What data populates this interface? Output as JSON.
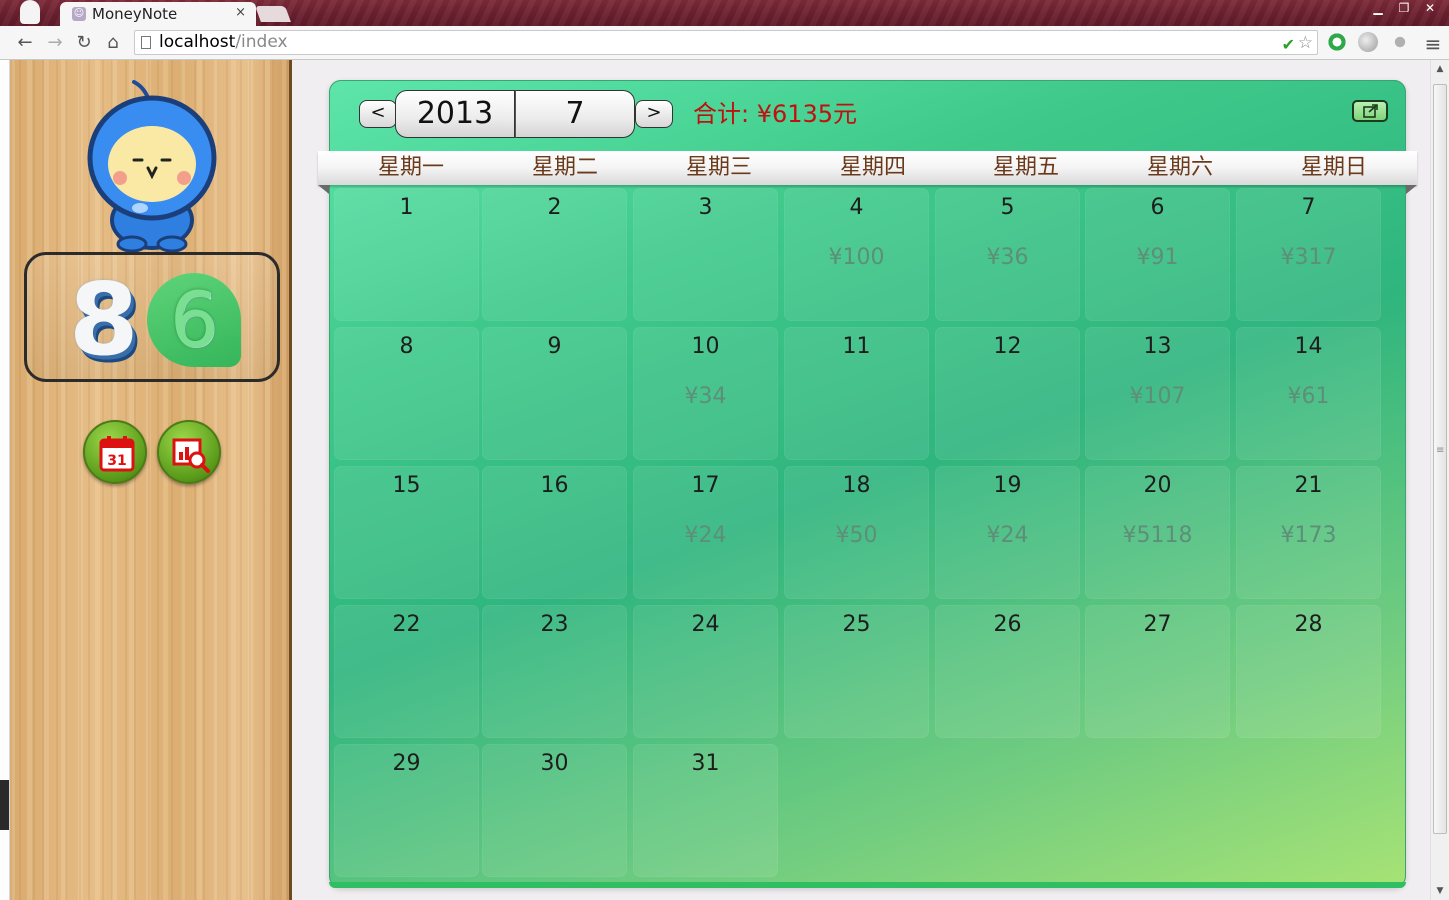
{
  "browser": {
    "tab_title": "MoneyNote",
    "tab_close": "×",
    "url_host": "localhost",
    "url_path": "/index",
    "nav": {
      "back": "←",
      "forward": "→",
      "reload": "↻",
      "home": "⌂"
    },
    "window_buttons": {
      "minimize": "▁",
      "restore": "❐",
      "close": "✕"
    }
  },
  "sidebar": {
    "counter_digit_1": "8",
    "counter_digit_2": "6",
    "buttons": [
      {
        "name": "calendar-button",
        "icon": "calendar-icon",
        "label": "31"
      },
      {
        "name": "stats-search-button",
        "icon": "chart-search-icon"
      }
    ]
  },
  "calendar": {
    "prev": "<",
    "next": ">",
    "year": "2013",
    "month": "7",
    "total_label": "合计: ¥6135元",
    "weekdays": [
      "星期一",
      "星期二",
      "星期三",
      "星期四",
      "星期五",
      "星期六",
      "星期日"
    ],
    "days": [
      {
        "d": "1",
        "amt": ""
      },
      {
        "d": "2",
        "amt": ""
      },
      {
        "d": "3",
        "amt": ""
      },
      {
        "d": "4",
        "amt": "¥100"
      },
      {
        "d": "5",
        "amt": "¥36"
      },
      {
        "d": "6",
        "amt": "¥91"
      },
      {
        "d": "7",
        "amt": "¥317"
      },
      {
        "d": "8",
        "amt": ""
      },
      {
        "d": "9",
        "amt": ""
      },
      {
        "d": "10",
        "amt": "¥34"
      },
      {
        "d": "11",
        "amt": ""
      },
      {
        "d": "12",
        "amt": ""
      },
      {
        "d": "13",
        "amt": "¥107"
      },
      {
        "d": "14",
        "amt": "¥61"
      },
      {
        "d": "15",
        "amt": ""
      },
      {
        "d": "16",
        "amt": ""
      },
      {
        "d": "17",
        "amt": "¥24"
      },
      {
        "d": "18",
        "amt": "¥50"
      },
      {
        "d": "19",
        "amt": "¥24"
      },
      {
        "d": "20",
        "amt": "¥5118"
      },
      {
        "d": "21",
        "amt": "¥173"
      },
      {
        "d": "22",
        "amt": ""
      },
      {
        "d": "23",
        "amt": ""
      },
      {
        "d": "24",
        "amt": ""
      },
      {
        "d": "25",
        "amt": ""
      },
      {
        "d": "26",
        "amt": ""
      },
      {
        "d": "27",
        "amt": ""
      },
      {
        "d": "28",
        "amt": ""
      },
      {
        "d": "29",
        "amt": ""
      },
      {
        "d": "30",
        "amt": ""
      },
      {
        "d": "31",
        "amt": ""
      }
    ]
  },
  "colors": {
    "total_text": "#c01010",
    "amount_text": "#5d8f78",
    "weekday_text": "#6b3a1a",
    "calendar_green": "#3ec98a"
  }
}
